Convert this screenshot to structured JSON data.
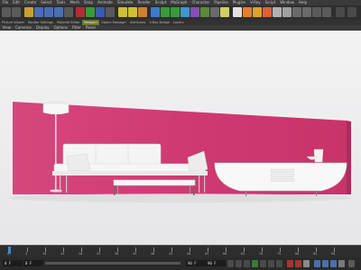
{
  "app": {
    "menu": [
      "File",
      "Edit",
      "Create",
      "Select",
      "Tools",
      "Mesh",
      "Snap",
      "Animate",
      "Simulate",
      "Render",
      "Sculpt",
      "MoGraph",
      "Character",
      "Pipeline",
      "Plugins",
      "V-Ray",
      "Script",
      "Window",
      "Help"
    ],
    "tabs": [
      "Picture Viewer",
      "Render Settings",
      "Material Editor",
      "Viewport",
      "Object Manager",
      "Attributes",
      "V-Ray Bridge",
      "Layers"
    ],
    "active_tab_index": 3,
    "view_menu": [
      "View",
      "Cameras",
      "Display",
      "Options",
      "Filter",
      "Panel"
    ],
    "toolbar_icons": [
      "undo-icon",
      "redo-icon",
      "live-select-icon",
      "move-icon",
      "scale-icon",
      "rotate-icon",
      "recent-tools-icon",
      "x-axis-icon",
      "y-axis-icon",
      "z-axis-icon",
      "coordinate-system-icon",
      "render-view-icon",
      "render-picture-viewer-icon",
      "render-settings-icon",
      "cube-icon",
      "pen-icon",
      "subdivision-icon",
      "array-icon",
      "deformer-icon",
      "floor-icon",
      "camera-icon",
      "light-icon",
      "vray-icon",
      "vray-render-icon",
      "vray-material-icon",
      "vray-light-icon",
      "vray-dome-icon",
      "vray-settings-icon",
      "vray-vfb-icon",
      "vray-proxy-icon",
      "layout-icon",
      "sphere-icon",
      "settings-icon",
      "help-icon",
      "prev-icon",
      "next-icon",
      "expand-icon"
    ]
  },
  "timeline": {
    "ticks": [
      "0",
      "5",
      "10",
      "15",
      "20",
      "25",
      "30",
      "35",
      "40",
      "45",
      "50",
      "55",
      "60",
      "65",
      "70",
      "75",
      "80",
      "85",
      "90"
    ]
  },
  "transport": {
    "start_frame": "0 F",
    "current_frame": "0 F",
    "end_frame": "90 F",
    "max_frame": "90 F"
  },
  "colors": {
    "wall": "#d13a72",
    "floor": "#f1f1f2",
    "furniture": "#f7f7f7",
    "active_tab": "#6a7a2a"
  }
}
